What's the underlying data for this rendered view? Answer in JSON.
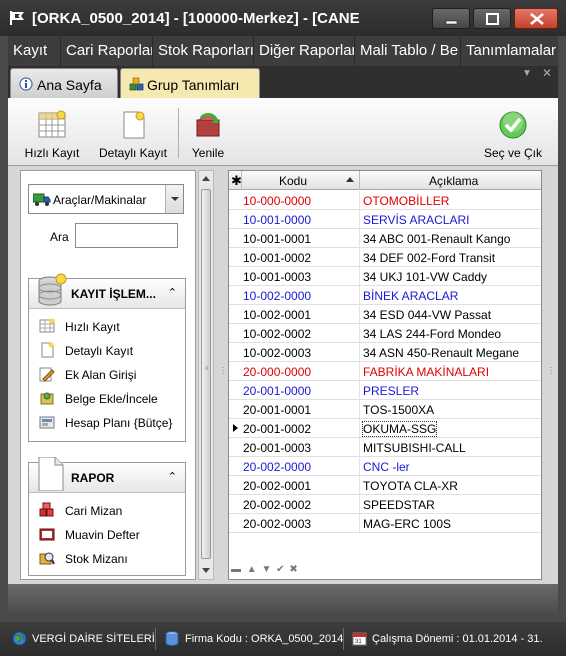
{
  "window": {
    "title": "[ORKA_0500_2014]  -  [100000-Merkez]  -  [CANE"
  },
  "menu": {
    "items": [
      "Kayıt",
      "Cari Raporlar",
      "Stok Raporları",
      "Diğer Raporlar",
      "Mali Tablo / Be",
      "Tanımlamalar"
    ]
  },
  "tabs": [
    {
      "label": "Ana Sayfa",
      "icon": "info-icon",
      "active": false
    },
    {
      "label": "Grup Tanımları",
      "icon": "group-cubes-icon",
      "active": true
    }
  ],
  "toolbar": {
    "hizli_kayit": "Hızlı Kayıt",
    "detayli_kayit": "Detaylı Kayıt",
    "yenile": "Yenile",
    "sec_ve_cik": "Seç ve Çık"
  },
  "filter": {
    "category": "Araçlar/Makinalar",
    "search_label": "Ara",
    "search_value": ""
  },
  "kayit_group": {
    "title": "KAYIT İŞLEM...",
    "items": [
      "Hızlı Kayıt",
      "Detaylı Kayıt",
      "Ek Alan Girişi",
      "Belge Ekle/İncele",
      "Hesap Planı {Bütçe}"
    ]
  },
  "rapor_group": {
    "title": "RAPOR",
    "items": [
      "Cari Mizan",
      "Muavin Defter",
      "Stok Mizanı"
    ]
  },
  "grid": {
    "columns": [
      "Kodu",
      "Açıklama"
    ],
    "selected_index": 12,
    "rows": [
      {
        "kodu": "10-000-0000",
        "aciklama": "OTOMOBİLLER",
        "style": "red"
      },
      {
        "kodu": "10-001-0000",
        "aciklama": "SERVİS ARACLARI",
        "style": "blue"
      },
      {
        "kodu": "10-001-0001",
        "aciklama": "34 ABC 001-Renault Kango",
        "style": "normal"
      },
      {
        "kodu": "10-001-0002",
        "aciklama": "34 DEF 002-Ford Transit",
        "style": "normal"
      },
      {
        "kodu": "10-001-0003",
        "aciklama": "34 UKJ 101-VW Caddy",
        "style": "normal"
      },
      {
        "kodu": "10-002-0000",
        "aciklama": "BİNEK ARACLAR",
        "style": "blue"
      },
      {
        "kodu": "10-002-0001",
        "aciklama": "34 ESD 044-VW Passat",
        "style": "normal"
      },
      {
        "kodu": "10-002-0002",
        "aciklama": "34 LAS 244-Ford Mondeo",
        "style": "normal"
      },
      {
        "kodu": "10-002-0003",
        "aciklama": "34 ASN 450-Renault Megane",
        "style": "normal"
      },
      {
        "kodu": "20-000-0000",
        "aciklama": "FABRİKA MAKİNALARI",
        "style": "red"
      },
      {
        "kodu": "20-001-0000",
        "aciklama": "PRESLER",
        "style": "blue"
      },
      {
        "kodu": "20-001-0001",
        "aciklama": "TOS-1500XA",
        "style": "normal"
      },
      {
        "kodu": "20-001-0002",
        "aciklama": "OKUMA-SSG",
        "style": "normal"
      },
      {
        "kodu": "20-001-0003",
        "aciklama": "MITSUBISHI-CALL",
        "style": "normal"
      },
      {
        "kodu": "20-002-0000",
        "aciklama": "CNC -ler",
        "style": "blue"
      },
      {
        "kodu": "20-002-0001",
        "aciklama": "TOYOTA CLA-XR",
        "style": "normal"
      },
      {
        "kodu": "20-002-0002",
        "aciklama": "SPEEDSTAR",
        "style": "normal"
      },
      {
        "kodu": "20-002-0003",
        "aciklama": "MAG-ERC 100S",
        "style": "normal"
      }
    ]
  },
  "status": {
    "vergi": "VERGİ DAİRE SİTELERİ",
    "firma": "Firma Kodu : ORKA_0500_2014",
    "donem": "Çalışma Dönemi : 01.01.2014 - 31."
  },
  "colors": {
    "active_tab": "#f6e9b0",
    "red_row": "#e00000",
    "blue_row": "#1a1ad6"
  }
}
